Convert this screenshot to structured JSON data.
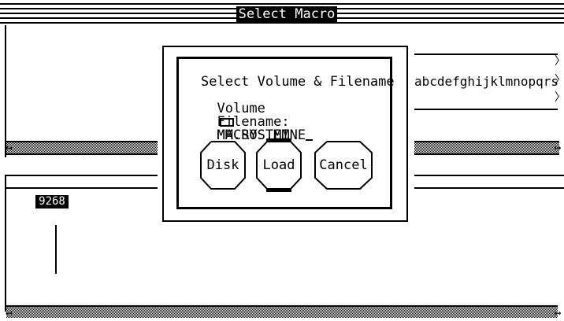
{
  "window": {
    "title": "Select Macro"
  },
  "dialog": {
    "prompt": "Select Volume & Filename",
    "volume_label": "Volume",
    "volume_icon": "folder-icon",
    "volume_value": "MM.SYSTEM",
    "filename_label": "Filename:",
    "filename_value": "MACROS.MINE",
    "buttons": {
      "disk": "Disk",
      "load": "Load",
      "cancel": "Cancel"
    },
    "default_button": "Load"
  },
  "right_panel": {
    "text": "abcdefghijklmnopqrs"
  },
  "lower_panel": {
    "badge": "9268"
  }
}
